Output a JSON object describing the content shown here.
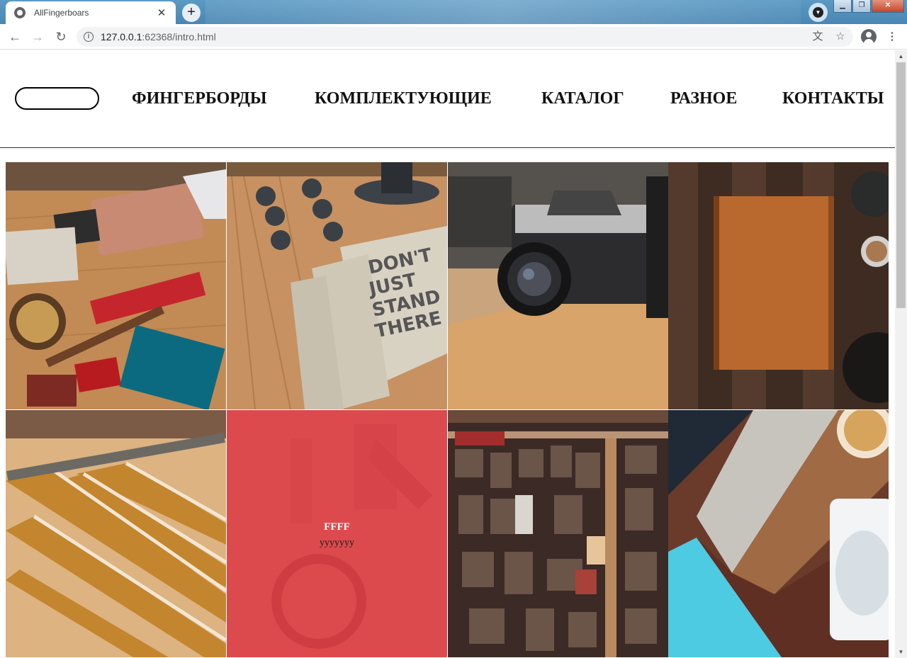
{
  "browser": {
    "tab_title": "AllFingerboars",
    "url_host": "127.0.0.1",
    "url_path": ":62368/intro.html"
  },
  "site": {
    "nav": [
      {
        "label": "ФИНГЕРБОРДЫ"
      },
      {
        "label": "КОМПЛЕКТУЮЩИЕ"
      },
      {
        "label": "КАТАЛОГ"
      },
      {
        "label": "РАЗНОЕ"
      },
      {
        "label": "КОНТАКТЫ"
      }
    ]
  },
  "gallery": {
    "hover_tile": {
      "heading": "FFFF",
      "subtext": "yyyyyyy"
    },
    "tiles": [
      {
        "name": "flatlay-crafts"
      },
      {
        "name": "notebooks-dont-just-stand-there"
      },
      {
        "name": "film-camera"
      },
      {
        "name": "wooden-book"
      },
      {
        "name": "folding-rulers"
      },
      {
        "name": "tools-hover"
      },
      {
        "name": "wood-letters"
      },
      {
        "name": "coffee-table"
      }
    ]
  },
  "colors": {
    "overlay_red": "#e83e44",
    "header_rule": "#333333"
  }
}
